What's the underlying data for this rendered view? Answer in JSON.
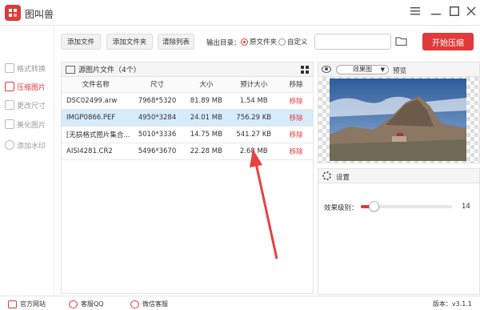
{
  "app": {
    "title": "图叫兽"
  },
  "sidebar": {
    "items": [
      {
        "label": "格式转换",
        "active": false
      },
      {
        "label": "压缩图片",
        "active": true
      },
      {
        "label": "更改尺寸",
        "active": false
      },
      {
        "label": "美化图片",
        "active": false
      },
      {
        "label": "添加水印",
        "active": false
      }
    ]
  },
  "toolbar": {
    "add_file": "添加文件",
    "add_folder": "添加文件夹",
    "clear_list": "清除列表",
    "output_dir_label": "输出目录：",
    "radio_original": "原文件夹",
    "radio_custom": "自定义",
    "selected_output": "原文件夹",
    "path_value": "",
    "start_button": "开始压缩"
  },
  "file_panel": {
    "header": "源图片文件（4个）",
    "columns": [
      "文件名称",
      "尺寸",
      "大小",
      "预计大小",
      "移除"
    ],
    "rows": [
      {
        "name": "DSC02499.arw",
        "size": "7968*5320",
        "filesize": "81.89 MB",
        "estimated": "1.54 MB",
        "remove": "移除"
      },
      {
        "name": "IMGP0866.PEF",
        "size": "4950*3284",
        "filesize": "24.01 MB",
        "estimated": "756.29 KB",
        "remove": "移除"
      },
      {
        "name": "[无损格式图片集合...",
        "size": "5010*3336",
        "filesize": "14.75 MB",
        "estimated": "541.27 KB",
        "remove": "移除"
      },
      {
        "name": "AISI4281.CR2",
        "size": "5496*3670",
        "filesize": "22.28 MB",
        "estimated": "2.68 MB",
        "remove": "移除"
      }
    ],
    "selected_row": 1
  },
  "preview": {
    "effect_select": "效果图",
    "label": "预览"
  },
  "settings": {
    "title": "设置",
    "level_label": "效果级别：",
    "level_value": "14",
    "level_fraction": 0.14
  },
  "footer": {
    "website": "官方网站",
    "qq": "客服QQ",
    "wechat": "微信客服",
    "version": "版本：v3.1.1"
  },
  "colors": {
    "accent": "#e03a3a",
    "selected_row": "#d7ecfa"
  }
}
